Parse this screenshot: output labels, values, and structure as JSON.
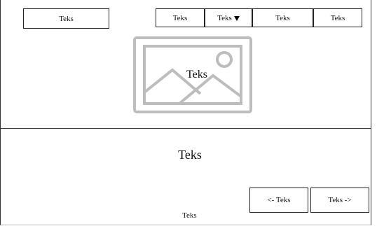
{
  "nav": {
    "logo_label": "Teks",
    "items": [
      {
        "label": "Teks"
      },
      {
        "label": "Teks",
        "has_dropdown": true
      },
      {
        "label": "Teks"
      },
      {
        "label": "Teks"
      }
    ]
  },
  "hero": {
    "image_icon": "image-placeholder-icon",
    "caption": "Teks"
  },
  "section": {
    "title": "Teks"
  },
  "pagination": {
    "prev_label": "<- Teks",
    "next_label": "Teks ->"
  },
  "footer": {
    "text": "Teks"
  },
  "colors": {
    "border": "#222222",
    "placeholder_gray": "#bdbdbd"
  }
}
